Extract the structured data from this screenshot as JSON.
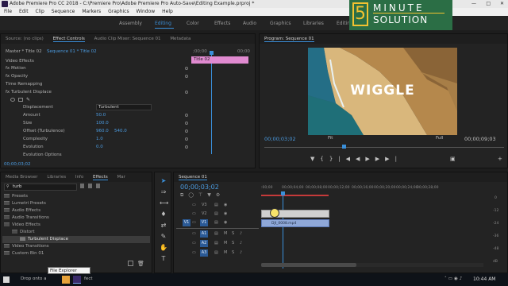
{
  "window": {
    "title": "Adobe Premiere Pro CC 2018 - C:\\Premiere Pro\\Adobe Premiere Pro Auto-Save\\Editing Example.prproj *"
  },
  "menu": [
    "File",
    "Edit",
    "Clip",
    "Sequence",
    "Markers",
    "Graphics",
    "Window",
    "Help"
  ],
  "workspaces": {
    "items": [
      "Assembly",
      "Editing",
      "Color",
      "Effects",
      "Audio",
      "Graphics",
      "Libraries",
      "Editing 2"
    ],
    "active": "Editing"
  },
  "brand": {
    "line1": "MINUTE",
    "line2": "SOLUTION",
    "digit": "5"
  },
  "effect_controls": {
    "tabs": [
      "Source: (no clips)",
      "Effect Controls",
      "Audio Clip Mixer: Sequence 01",
      "Metadata"
    ],
    "active_tab": "Effect Controls",
    "master": "Master * Title 02",
    "clip": "Sequence 01 * Title 02",
    "ruler_start": ";00;00",
    "ruler_end": "00;00",
    "clip_label": "Title 02",
    "section": "Video Effects",
    "rows": [
      {
        "label": "fx  Motion"
      },
      {
        "label": "fx  Opacity"
      },
      {
        "label": "    Time Remapping"
      },
      {
        "label": "fx  Turbulent Displace"
      },
      {
        "label": "Displacement",
        "value": "Turbulent"
      },
      {
        "label": "Amount",
        "value": "50.0"
      },
      {
        "label": "Size",
        "value": "100.0"
      },
      {
        "label": "Offset (Turbulence)",
        "value": "960.0",
        "value2": "540.0"
      },
      {
        "label": "Complexity",
        "value": "1.0"
      },
      {
        "label": "Evolution",
        "value": "0.0"
      },
      {
        "label": "Evolution Options"
      }
    ],
    "timecode": "00;00;03;02"
  },
  "program": {
    "tab": "Program: Sequence 01",
    "overlay_text": "WIGGLE",
    "timecode": "00;00;03;02",
    "fit": "Fit",
    "quality": "Full",
    "duration": "00;00;09;03"
  },
  "effects_panel": {
    "tabs": [
      "Media Browser",
      "Libraries",
      "Info",
      "Effects",
      "Mar"
    ],
    "active_tab": "Effects",
    "search_value": "turb",
    "tree": [
      {
        "label": "Presets",
        "indent": 0
      },
      {
        "label": "Lumetri Presets",
        "indent": 0
      },
      {
        "label": "Audio Effects",
        "indent": 0
      },
      {
        "label": "Audio Transitions",
        "indent": 0
      },
      {
        "label": "Video Effects",
        "indent": 0
      },
      {
        "label": "Distort",
        "indent": 1
      },
      {
        "label": "Turbulent Displace",
        "indent": 2,
        "selected": true
      },
      {
        "label": "Video Transitions",
        "indent": 0
      },
      {
        "label": "Custom Bin 01",
        "indent": 0
      }
    ]
  },
  "sequence": {
    "tab": "Sequence 01",
    "timecode": "00;00;03;02",
    "ruler": [
      ":00;00",
      "00;00;04;00",
      "00;00;08;00",
      "00;00;12;00",
      "00;00;16;00",
      "00;00;20;00",
      "00;00;24;00",
      "00;00;28;00"
    ],
    "tracks": [
      {
        "name": "V3"
      },
      {
        "name": "V2"
      },
      {
        "name": "V1",
        "target": "V1"
      },
      {
        "name": "A1",
        "target": "A1"
      },
      {
        "name": "A2"
      },
      {
        "name": "A3"
      }
    ],
    "clip_v1": "DJI_0008.mp4",
    "meter_ticks": [
      "0",
      "-12",
      "-24",
      "-36",
      "-48",
      "dB"
    ]
  },
  "taskbar": {
    "search": "Drop onto a",
    "tooltip": "File Explorer",
    "after": "fect",
    "time": "10:44 AM"
  },
  "colors": {
    "accent": "#3a8fd9",
    "pink_clip": "#e08ad0",
    "video_clip": "#8fa8d8"
  }
}
